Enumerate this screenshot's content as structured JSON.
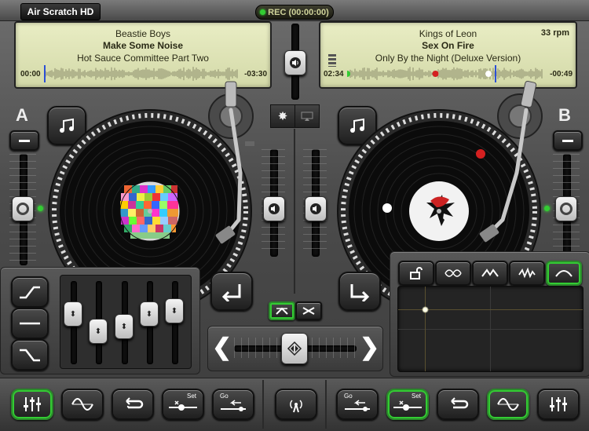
{
  "app": {
    "title": "Air Scratch HD"
  },
  "rec": {
    "label": "REC (00:00:00)"
  },
  "deck_a": {
    "letter": "A",
    "artist": "Beastie Boys",
    "track": "Make Some Noise",
    "album": "Hot Sauce Committee Part Two",
    "time_elapsed": "00:00",
    "time_remaining": "-03:30",
    "playhead": 0.0
  },
  "deck_b": {
    "letter": "B",
    "artist": "Kings of Leon",
    "track": "Sex On Fire",
    "album": "Only By the Night (Deluxe Version)",
    "rpm": "33 rpm",
    "time_elapsed": "02:34",
    "time_remaining": "-00:49",
    "playhead": 0.76
  },
  "colors": {
    "accent_green": "#33cc33",
    "lcd_bg": "#e1e6b8",
    "cue_red": "#d42020"
  },
  "icons": {
    "settings": "gear-icon",
    "airplay": "airplay-icon",
    "note": "music-note-icon",
    "volume": "speaker-icon",
    "minus": "minus-icon"
  },
  "filter_tabs": [
    "lock-icon",
    "phaser-icon",
    "flanger-icon",
    "distortion-icon",
    "lowpass-icon"
  ],
  "bottom_bar": {
    "left": [
      "eq-sliders-icon",
      "sine-wave-icon",
      "loop-icon",
      "cue-set-icon",
      "go-cue-icon"
    ],
    "center": "antenna-icon",
    "right": [
      "go-cue-icon",
      "cue-set-icon",
      "loop-icon",
      "sine-wave-icon",
      "eq-sliders-icon"
    ],
    "set_label": "Set",
    "go_label": "Go"
  }
}
